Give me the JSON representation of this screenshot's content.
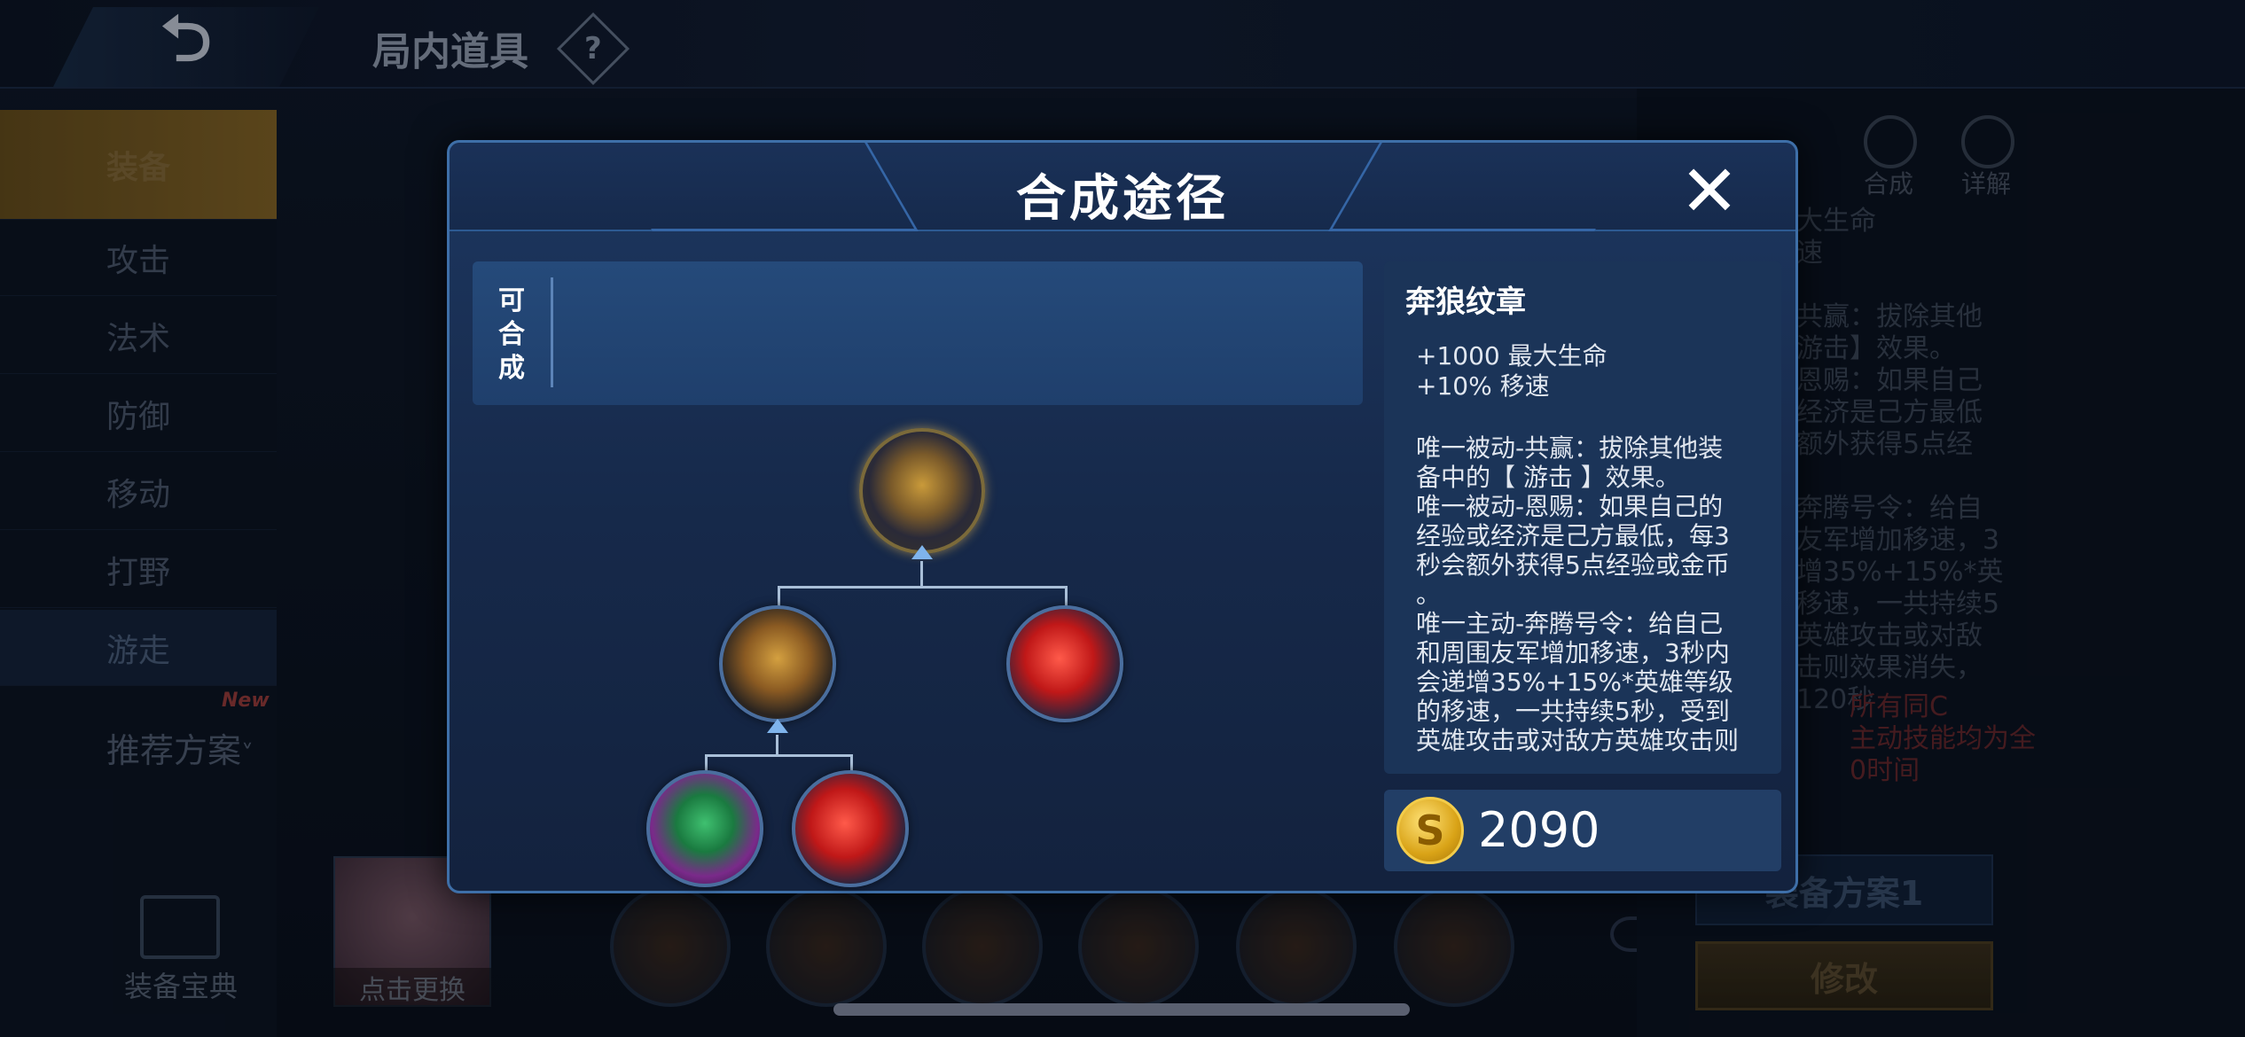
{
  "topbar": {
    "back_icon": "back-arrow-icon",
    "title": "局内道具",
    "help": "?"
  },
  "sidebar": {
    "items": [
      {
        "label": "装备",
        "active": true
      },
      {
        "label": "攻击"
      },
      {
        "label": "法术"
      },
      {
        "label": "防御"
      },
      {
        "label": "移动"
      },
      {
        "label": "打野"
      },
      {
        "label": "游走"
      }
    ],
    "recommend": "推荐方案",
    "recommend_arrow": "˅",
    "new_badge": "New",
    "dictionary": "装备宝典"
  },
  "hero": {
    "change_label": "点击更换"
  },
  "right": {
    "compose_label": "合成",
    "detail_label": "详解",
    "bg_text": "大生命\n速\n\n共赢：拔除其他\n 游击】效果。\n恩赐：如果自己\n经济是己方最低\n额外获得5点经\n\n奔腾号令：给自\n友军增加移速，3\n增35%+15%*英\n移速，一共持续5\n英雄攻击或对敌\n击则效果消失，\n 120秒",
    "bg_red": "所有同C\n主动技能均为全\n0时间",
    "plan_button": "装备方案1",
    "modify_button": "修改"
  },
  "modal": {
    "title": "合成途径",
    "close": "✕",
    "craftable_label": "可\n合\n成",
    "item": {
      "name": "奔狼纹章",
      "stats": "+1000 最大生命\n+10% 移速",
      "description": "唯一被动-共赢：拔除其他装\n备中的【 游击 】效果。\n唯一被动-恩赐：如果自己的\n经验或经济是己方最低，每3\n秒会额外获得5点经验或金币\n。\n唯一主动-奔腾号令：给自己\n和周围友军增加移速，3秒内\n会递增35%+15%*英雄等级\n的移速，一共持续5秒，受到\n英雄攻击或对敌方英雄攻击则",
      "price": "2090",
      "coin_symbol": "S"
    }
  },
  "colors": {
    "accent_gold": "#d9a317",
    "modal_border": "#3e6fa8",
    "red_text": "#c0303a"
  }
}
